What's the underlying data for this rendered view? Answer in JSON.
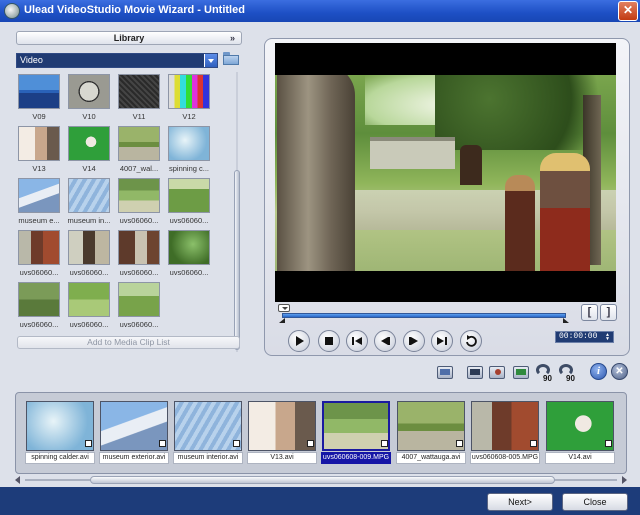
{
  "window": {
    "title": "Ulead VideoStudio Movie Wizard - Untitled",
    "close_icon": "close-icon"
  },
  "library": {
    "button_label": "Library",
    "category": "Video",
    "add_clip_label": "Add to Media Clip List",
    "items": [
      {
        "label": "V09",
        "thumb": "sea-horizon"
      },
      {
        "label": "V10",
        "thumb": "countdown-5"
      },
      {
        "label": "V11",
        "thumb": "dark-noise"
      },
      {
        "label": "V12",
        "thumb": "color-bars"
      },
      {
        "label": "V13",
        "thumb": "woman-laptop"
      },
      {
        "label": "V14",
        "thumb": "green-screen"
      },
      {
        "label": "4007_wal...",
        "thumb": "road-trees"
      },
      {
        "label": "spinning c...",
        "thumb": "sky-sculpture"
      },
      {
        "label": "museum e...",
        "thumb": "museum-exterior"
      },
      {
        "label": "museum in...",
        "thumb": "museum-interior"
      },
      {
        "label": "uvs06060...",
        "thumb": "park-scene"
      },
      {
        "label": "uvs06060...",
        "thumb": "field-scene"
      },
      {
        "label": "uvs06060...",
        "thumb": "costume-women"
      },
      {
        "label": "uvs06060...",
        "thumb": "costume-pair"
      },
      {
        "label": "uvs06060...",
        "thumb": "costume-group"
      },
      {
        "label": "uvs06060...",
        "thumb": "garden-trees"
      },
      {
        "label": "uvs06060...",
        "thumb": "barn-yard"
      },
      {
        "label": "uvs06060...",
        "thumb": "green-field"
      },
      {
        "label": "uvs06060...",
        "thumb": "meadow"
      }
    ]
  },
  "player": {
    "timecode": "00:00:00",
    "mark_in": "[",
    "mark_out": "]",
    "progress": 0
  },
  "clips": [
    {
      "label": "spinning calder.avi",
      "thumb": "sky-sculpture",
      "selected": false
    },
    {
      "label": "museum exterior.avi",
      "thumb": "museum-exterior",
      "selected": false
    },
    {
      "label": "museum interior.avi",
      "thumb": "museum-interior",
      "selected": false
    },
    {
      "label": "V13.avi",
      "thumb": "woman-laptop",
      "selected": false
    },
    {
      "label": "uvs060608-009.MPG",
      "thumb": "park-scene",
      "selected": true
    },
    {
      "label": "4007_wattauga.avi",
      "thumb": "road-trees",
      "selected": false
    },
    {
      "label": "uvs060608-005.MPG",
      "thumb": "costume-women",
      "selected": false
    },
    {
      "label": "V14.avi",
      "thumb": "green-screen",
      "selected": false
    }
  ],
  "footer": {
    "next_label": "Next>",
    "close_label": "Close"
  },
  "colors": {
    "accent": "#1d3c7a",
    "selection": "#1515a6",
    "scrub": "#2a66c8"
  }
}
